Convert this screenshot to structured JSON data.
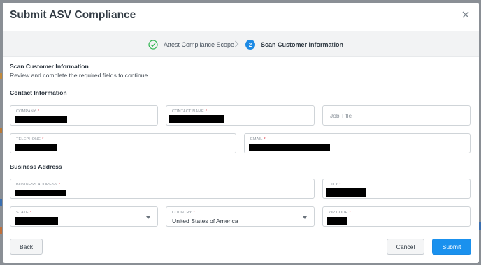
{
  "modal": {
    "title": "Submit ASV Compliance"
  },
  "stepper": {
    "steps": [
      {
        "label": "Attest Compliance Scope",
        "status": "complete",
        "icon": "check-circle-icon"
      },
      {
        "number": "2",
        "label": "Scan Customer Information",
        "status": "active"
      }
    ]
  },
  "section": {
    "title": "Scan Customer Information",
    "description": "Review and complete the required fields to continue."
  },
  "contact": {
    "heading": "Contact Information",
    "company": {
      "label": "COMPANY",
      "required": "*",
      "value_redacted": true
    },
    "contact_name": {
      "label": "CONTACT NAME",
      "required": "*",
      "value_redacted": true
    },
    "job_title": {
      "placeholder": "Job Title"
    },
    "telephone": {
      "label": "TELEPHONE",
      "required": "*",
      "value_redacted": true
    },
    "email": {
      "label": "EMAIL",
      "required": "*",
      "value_redacted": true
    }
  },
  "address": {
    "heading": "Business Address",
    "business_address": {
      "label": "BUSINESS ADDRESS",
      "required": "*",
      "value_redacted": true
    },
    "city": {
      "label": "CITY",
      "required": "*",
      "value_redacted": true
    },
    "state": {
      "label": "STATE",
      "required": "*",
      "value_redacted": true
    },
    "country": {
      "label": "COUNTRY",
      "required": "*",
      "value": "United States of America"
    },
    "zip": {
      "label": "ZIP CODE",
      "required": "*",
      "value_redacted": true
    }
  },
  "footer": {
    "back_label": "Back",
    "cancel_label": "Cancel",
    "submit_label": "Submit"
  },
  "colors": {
    "primary": "#1a91ee",
    "success": "#2eb44f",
    "required": "#d9333f",
    "backdrop": "#8a8f95"
  }
}
